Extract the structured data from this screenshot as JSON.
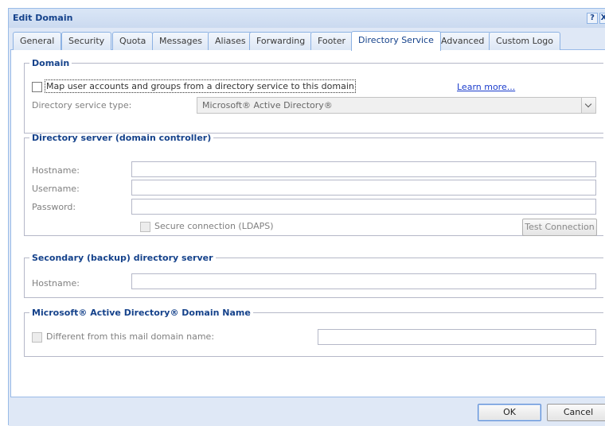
{
  "window": {
    "title": "Edit Domain",
    "help_label": "?",
    "close_label": "X"
  },
  "tabs": [
    {
      "label": "General"
    },
    {
      "label": "Security"
    },
    {
      "label": "Quota"
    },
    {
      "label": "Messages"
    },
    {
      "label": "Aliases"
    },
    {
      "label": "Forwarding"
    },
    {
      "label": "Footer"
    },
    {
      "label": "Directory Service",
      "active": true
    },
    {
      "label": "Advanced"
    },
    {
      "label": "Custom Logo"
    }
  ],
  "domain_section": {
    "legend": "Domain",
    "map_checkbox_label": "Map user accounts and groups from a directory service to this domain",
    "map_checked": false,
    "learn_more": "Learn more...",
    "service_type_label": "Directory service type:",
    "service_type_value": "Microsoft® Active Directory®"
  },
  "directory_server": {
    "legend": "Directory server (domain controller)",
    "hostname_label": "Hostname:",
    "hostname_value": "",
    "username_label": "Username:",
    "username_value": "",
    "password_label": "Password:",
    "password_value": "",
    "secure_label": "Secure connection (LDAPS)",
    "secure_checked": false,
    "test_button": "Test Connection"
  },
  "secondary_server": {
    "legend": "Secondary (backup) directory server",
    "hostname_label": "Hostname:",
    "hostname_value": ""
  },
  "ad_domain_name": {
    "legend": "Microsoft® Active Directory® Domain Name",
    "different_label": "Different from this mail domain name:",
    "different_checked": false,
    "domain_value": ""
  },
  "footer": {
    "ok_label": "OK",
    "cancel_label": "Cancel"
  },
  "colors": {
    "accent": "#15428b",
    "border": "#99bbe8",
    "link": "#1a3ccc"
  }
}
